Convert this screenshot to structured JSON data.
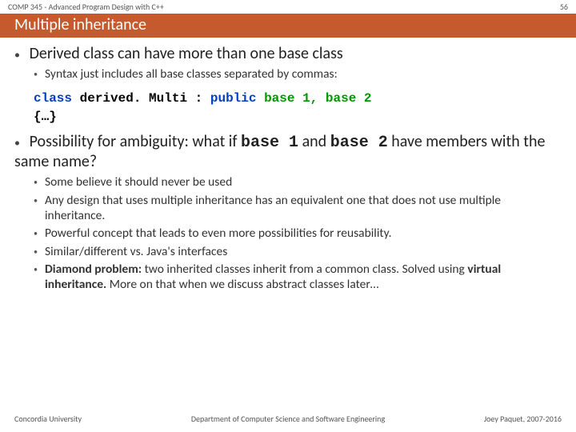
{
  "header": {
    "course": "COMP 345 - Advanced Program Design with C++",
    "slideNumber": "56",
    "title": "Multiple inheritance"
  },
  "bullets": {
    "b1": "Derived class can have more than one base class",
    "b1_1": "Syntax just includes all base classes separated by commas:",
    "code": {
      "class": "class",
      "derived": "derived. Multi",
      "colon": " : ",
      "public": "public",
      "bases": " base 1, base 2",
      "brace": "{…}"
    },
    "b2_pre": "Possibility for ambiguity: what if ",
    "b2_c1": "base 1",
    "b2_mid": " and ",
    "b2_c2": "base 2",
    "b2_post": " have members with the same name?",
    "b2_1": "Some believe it should never be used",
    "b2_2": "Any design that uses multiple inheritance has an equivalent one that does not use multiple inheritance.",
    "b2_3": "Powerful concept that leads to even more possibilities for reusability.",
    "b2_4": "Similar/different vs. Java's interfaces",
    "b2_5_strong1": "Diamond problem:",
    "b2_5_mid": " two inherited classes inherit from a common class. Solved using ",
    "b2_5_strong2": "virtual inheritance.",
    "b2_5_post": " More on that when we discuss abstract classes later…"
  },
  "footer": {
    "left": "Concordia University",
    "center": "Department of Computer Science and Software Engineering",
    "right": "Joey Paquet, 2007-2016"
  }
}
